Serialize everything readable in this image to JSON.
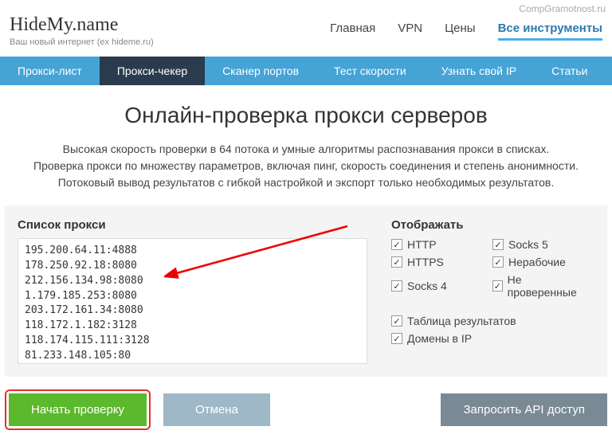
{
  "watermark": "CompGramotnost.ru",
  "logo": {
    "main": "HideMy.name",
    "sub": "Ваш новый интернет (ex hideme.ru)"
  },
  "topnav": [
    {
      "label": "Главная",
      "active": false
    },
    {
      "label": "VPN",
      "active": false
    },
    {
      "label": "Цены",
      "active": false
    },
    {
      "label": "Все инструменты",
      "active": true
    }
  ],
  "subnav": [
    {
      "label": "Прокси-лист",
      "dark": false
    },
    {
      "label": "Прокси-чекер",
      "dark": true
    },
    {
      "label": "Сканер портов",
      "dark": false
    },
    {
      "label": "Тест скорости",
      "dark": false
    },
    {
      "label": "Узнать свой IP",
      "dark": false
    },
    {
      "label": "Статьи",
      "dark": false
    }
  ],
  "title": "Онлайн-проверка прокси серверов",
  "desc_lines": [
    "Высокая скорость проверки в 64 потока и умные алгоритмы распознавания прокси в списках.",
    "Проверка прокси по множеству параметров, включая пинг, скорость соединения и степень анонимности.",
    "Потоковый вывод результатов с гибкой настройкой и экспорт только необходимых результатов."
  ],
  "proxy_label": "Список прокси",
  "proxy_list": "195.200.64.11:4888\n178.250.92.18:8080\n212.156.134.98:8080\n1.179.185.253:8080\n203.172.161.34:8080\n118.172.1.182:3128\n118.174.115.111:3128\n81.233.148.105:80",
  "display_label": "Отображать",
  "opts_group1": [
    {
      "label": "HTTP",
      "checked": true
    },
    {
      "label": "Socks 5",
      "checked": true
    },
    {
      "label": "HTTPS",
      "checked": true
    },
    {
      "label": "Нерабочие",
      "checked": true
    },
    {
      "label": "Socks 4",
      "checked": true
    },
    {
      "label": "Не проверенные",
      "checked": true
    }
  ],
  "opts_group2": [
    {
      "label": "Таблица результатов",
      "checked": true
    },
    {
      "label": "Домены в IP",
      "checked": true
    }
  ],
  "buttons": {
    "start": "Начать проверку",
    "cancel": "Отмена",
    "api": "Запросить API доступ"
  }
}
